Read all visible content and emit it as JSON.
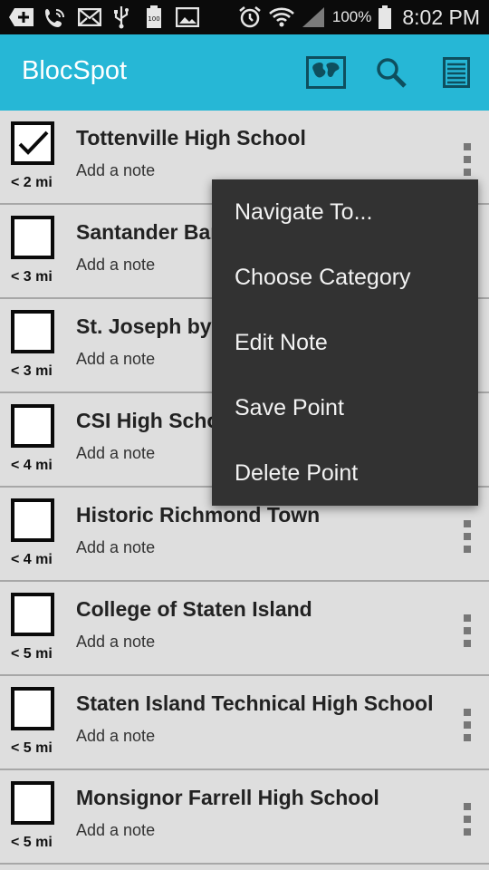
{
  "status_bar": {
    "battery_percent": "100%",
    "time": "8:02 PM",
    "icons": [
      "add-box-icon",
      "wifi-call-icon",
      "mail-icon",
      "usb-icon",
      "battery-full-icon",
      "image-icon",
      "alarm-icon",
      "wifi-icon",
      "signal-icon",
      "battery-icon"
    ]
  },
  "app_bar": {
    "title": "BlocSpot",
    "actions": [
      "map-icon",
      "search-icon",
      "list-icon"
    ]
  },
  "points": [
    {
      "title": "Tottenville High School",
      "note": "Add a note",
      "distance": "< 2 mi",
      "checked": true
    },
    {
      "title": "Santander Bank",
      "note": "Add a note",
      "distance": "< 3 mi",
      "checked": false
    },
    {
      "title": "St. Joseph by-the-Sea",
      "note": "Add a note",
      "distance": "< 3 mi",
      "checked": false
    },
    {
      "title": "CSI High School",
      "note": "Add a note",
      "distance": "< 4 mi",
      "checked": false
    },
    {
      "title": "Historic Richmond Town",
      "note": "Add a note",
      "distance": "< 4 mi",
      "checked": false
    },
    {
      "title": "College of Staten Island",
      "note": "Add a note",
      "distance": "< 5 mi",
      "checked": false
    },
    {
      "title": "Staten Island Technical High School",
      "note": "Add a note",
      "distance": "< 5 mi",
      "checked": false
    },
    {
      "title": "Monsignor Farrell High School",
      "note": "Add a note",
      "distance": "< 5 mi",
      "checked": false
    }
  ],
  "popup_menu": {
    "items": [
      "Navigate To...",
      "Choose Category",
      "Edit Note",
      "Save Point",
      "Delete Point"
    ]
  },
  "colors": {
    "app_bar": "#26b7d6",
    "list_background": "#dedede",
    "menu_background": "#323232",
    "action_icon": "#0e4f5e"
  }
}
